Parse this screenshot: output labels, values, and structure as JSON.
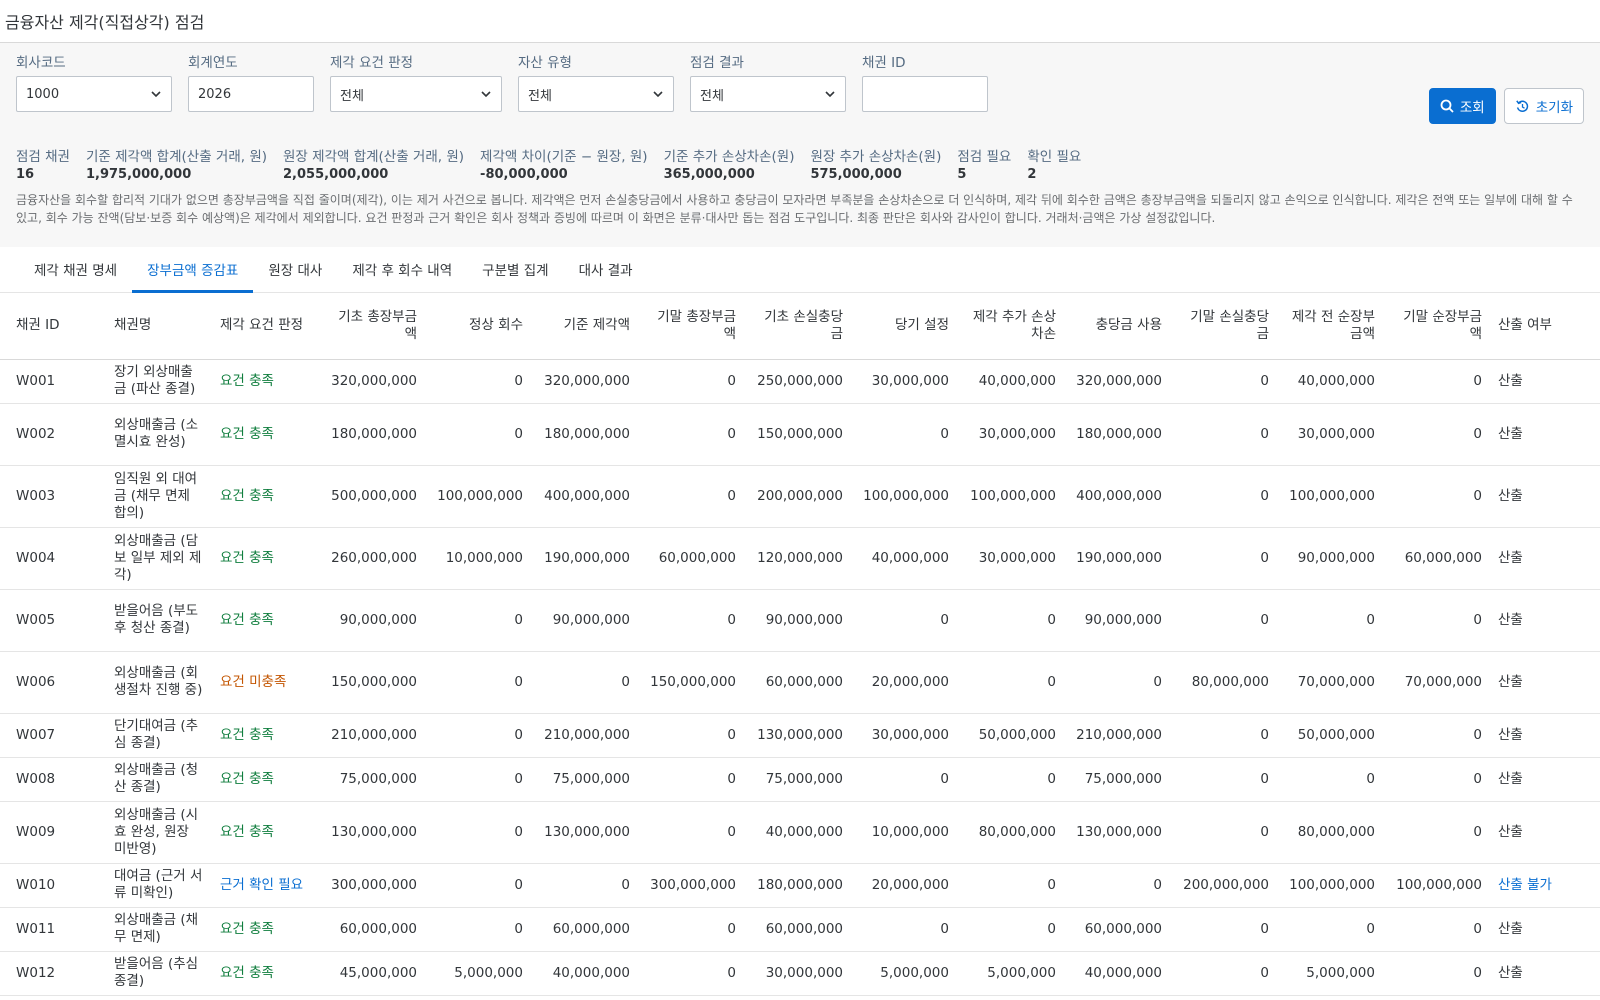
{
  "app": {
    "title": "금융자산 제각(직접상각) 점검"
  },
  "filters": {
    "company": {
      "label": "회사코드",
      "value": "1000"
    },
    "fiscal_year": {
      "label": "회계연도",
      "value": "2026"
    },
    "writeoff_judgement": {
      "label": "제각 요건 판정",
      "value": "전체"
    },
    "asset_type": {
      "label": "자산 유형",
      "value": "전체"
    },
    "check_result": {
      "label": "점검 결과",
      "value": "전체"
    },
    "receivable_id": {
      "label": "채권 ID",
      "value": "",
      "placeholder": ""
    },
    "search_label": "조회",
    "reset_label": "초기화"
  },
  "kpis": [
    {
      "label": "점검 채권",
      "value": "16"
    },
    {
      "label": "기준 제각액 합계(산출 거래, 원)",
      "value": "1,975,000,000"
    },
    {
      "label": "원장 제각액 합계(산출 거래, 원)",
      "value": "2,055,000,000"
    },
    {
      "label": "제각액 차이(기준 − 원장, 원)",
      "value": "-80,000,000"
    },
    {
      "label": "기준 추가 손상차손(원)",
      "value": "365,000,000"
    },
    {
      "label": "원장 추가 손상차손(원)",
      "value": "575,000,000"
    },
    {
      "label": "점검 필요",
      "value": "5"
    },
    {
      "label": "확인 필요",
      "value": "2"
    }
  ],
  "note": "금융자산을 회수할 합리적 기대가 없으면 총장부금액을 직접 줄이며(제각), 이는 제거 사건으로 봅니다. 제각액은 먼저 손실충당금에서 사용하고 충당금이 모자라면 부족분을 손상차손으로 더 인식하며, 제각 뒤에 회수한 금액은 총장부금액을 되돌리지 않고 손익으로 인식합니다. 제각은 전액 또는 일부에 대해 할 수 있고, 회수 가능 잔액(담보·보증 회수 예상액)은 제각에서 제외합니다. 요건 판정과 근거 확인은 회사 정책과 증빙에 따르며 이 화면은 분류·대사만 돕는 점검 도구입니다. 최종 판단은 회사와 감사인이 합니다. 거래처·금액은 가상 설정값입니다.",
  "tabs": [
    {
      "label": "제각 채권 명세",
      "active": false
    },
    {
      "label": "장부금액 증감표",
      "active": true
    },
    {
      "label": "원장 대사",
      "active": false
    },
    {
      "label": "제각 후 회수 내역",
      "active": false
    },
    {
      "label": "구분별 집계",
      "active": false
    },
    {
      "label": "대사 결과",
      "active": false
    }
  ],
  "table": {
    "headers": [
      "채권 ID",
      "채권명",
      "제각 요건 판정",
      "기초 총장부금액",
      "정상 회수",
      "기준 제각액",
      "기말 총장부금액",
      "기초 손실충당금",
      "당기 설정",
      "제각 추가 손상차손",
      "충당금 사용",
      "기말 손실충당금",
      "제각 전 순장부금액",
      "기말 순장부금액",
      "산출 여부"
    ],
    "rows": [
      {
        "id": "W001",
        "name": "장기 외상매출금 (파산 종결)",
        "judgement": "요건 충족",
        "status": "ok",
        "v": [
          "320,000,000",
          "0",
          "320,000,000",
          "0",
          "250,000,000",
          "30,000,000",
          "40,000,000",
          "320,000,000",
          "0",
          "40,000,000",
          "0"
        ],
        "calc": "산출",
        "calc_status": "normal"
      },
      {
        "id": "W002",
        "name": "외상매출금 (소멸시효 완성)",
        "judgement": "요건 충족",
        "status": "ok",
        "v": [
          "180,000,000",
          "0",
          "180,000,000",
          "0",
          "150,000,000",
          "0",
          "30,000,000",
          "180,000,000",
          "0",
          "30,000,000",
          "0"
        ],
        "calc": "산출",
        "calc_status": "normal"
      },
      {
        "id": "W003",
        "name": "임직원 외 대여금 (채무 면제 합의)",
        "judgement": "요건 충족",
        "status": "ok",
        "v": [
          "500,000,000",
          "100,000,000",
          "400,000,000",
          "0",
          "200,000,000",
          "100,000,000",
          "100,000,000",
          "400,000,000",
          "0",
          "100,000,000",
          "0"
        ],
        "calc": "산출",
        "calc_status": "normal"
      },
      {
        "id": "W004",
        "name": "외상매출금 (담보 일부 제외 제각)",
        "judgement": "요건 충족",
        "status": "ok",
        "v": [
          "260,000,000",
          "10,000,000",
          "190,000,000",
          "60,000,000",
          "120,000,000",
          "40,000,000",
          "30,000,000",
          "190,000,000",
          "0",
          "90,000,000",
          "60,000,000"
        ],
        "calc": "산출",
        "calc_status": "normal"
      },
      {
        "id": "W005",
        "name": "받을어음 (부도 후 청산 종결)",
        "judgement": "요건 충족",
        "status": "ok",
        "v": [
          "90,000,000",
          "0",
          "90,000,000",
          "0",
          "90,000,000",
          "0",
          "0",
          "90,000,000",
          "0",
          "0",
          "0"
        ],
        "calc": "산출",
        "calc_status": "normal"
      },
      {
        "id": "W006",
        "name": "외상매출금 (회생절차 진행 중)",
        "judgement": "요건 미충족",
        "status": "warn",
        "v": [
          "150,000,000",
          "0",
          "0",
          "150,000,000",
          "60,000,000",
          "20,000,000",
          "0",
          "0",
          "80,000,000",
          "70,000,000",
          "70,000,000"
        ],
        "calc": "산출",
        "calc_status": "normal"
      },
      {
        "id": "W007",
        "name": "단기대여금 (추심 종결)",
        "judgement": "요건 충족",
        "status": "ok",
        "v": [
          "210,000,000",
          "0",
          "210,000,000",
          "0",
          "130,000,000",
          "30,000,000",
          "50,000,000",
          "210,000,000",
          "0",
          "50,000,000",
          "0"
        ],
        "calc": "산출",
        "calc_status": "normal"
      },
      {
        "id": "W008",
        "name": "외상매출금 (청산 종결)",
        "judgement": "요건 충족",
        "status": "ok",
        "v": [
          "75,000,000",
          "0",
          "75,000,000",
          "0",
          "75,000,000",
          "0",
          "0",
          "75,000,000",
          "0",
          "0",
          "0"
        ],
        "calc": "산출",
        "calc_status": "normal"
      },
      {
        "id": "W009",
        "name": "외상매출금 (시효 완성, 원장 미반영)",
        "judgement": "요건 충족",
        "status": "ok",
        "v": [
          "130,000,000",
          "0",
          "130,000,000",
          "0",
          "40,000,000",
          "10,000,000",
          "80,000,000",
          "130,000,000",
          "0",
          "80,000,000",
          "0"
        ],
        "calc": "산출",
        "calc_status": "normal"
      },
      {
        "id": "W010",
        "name": "대여금 (근거 서류 미확인)",
        "judgement": "근거 확인 필요",
        "status": "info",
        "v": [
          "300,000,000",
          "0",
          "0",
          "300,000,000",
          "180,000,000",
          "20,000,000",
          "0",
          "0",
          "200,000,000",
          "100,000,000",
          "100,000,000"
        ],
        "calc": "산출 불가",
        "calc_status": "info"
      },
      {
        "id": "W011",
        "name": "외상매출금 (채무 면제)",
        "judgement": "요건 충족",
        "status": "ok",
        "v": [
          "60,000,000",
          "0",
          "60,000,000",
          "0",
          "60,000,000",
          "0",
          "0",
          "60,000,000",
          "0",
          "0",
          "0"
        ],
        "calc": "산출",
        "calc_status": "normal"
      },
      {
        "id": "W012",
        "name": "받을어음 (추심 종결)",
        "judgement": "요건 충족",
        "status": "ok",
        "v": [
          "45,000,000",
          "5,000,000",
          "40,000,000",
          "0",
          "30,000,000",
          "5,000,000",
          "5,000,000",
          "40,000,000",
          "0",
          "5,000,000",
          "0"
        ],
        "calc": "산출",
        "calc_status": "normal"
      }
    ]
  }
}
